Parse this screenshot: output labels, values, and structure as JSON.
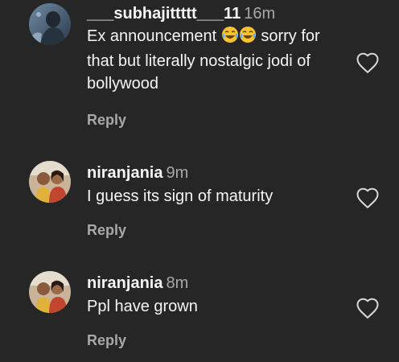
{
  "comments": [
    {
      "username": "___subhajittttt___11",
      "time": "16m",
      "text_before_emoji": "Ex announcement ",
      "emoji": [
        "laughing-tears-emoji",
        "laughing-tears-emoji"
      ],
      "text_after_emoji": " sorry for that but literally nostalgic jodi of bollywood",
      "reply_label": "Reply"
    },
    {
      "username": "niranjania",
      "time": "9m",
      "text": "I guess its sign of maturity",
      "reply_label": "Reply"
    },
    {
      "username": "niranjania",
      "time": "8m",
      "text": "Ppl have grown",
      "reply_label": "Reply"
    }
  ],
  "icons": {
    "like": "heart-outline-icon"
  },
  "colors": {
    "background": "#262626",
    "primary_text": "#f5f5f5",
    "secondary_text": "#a8a8a8"
  }
}
